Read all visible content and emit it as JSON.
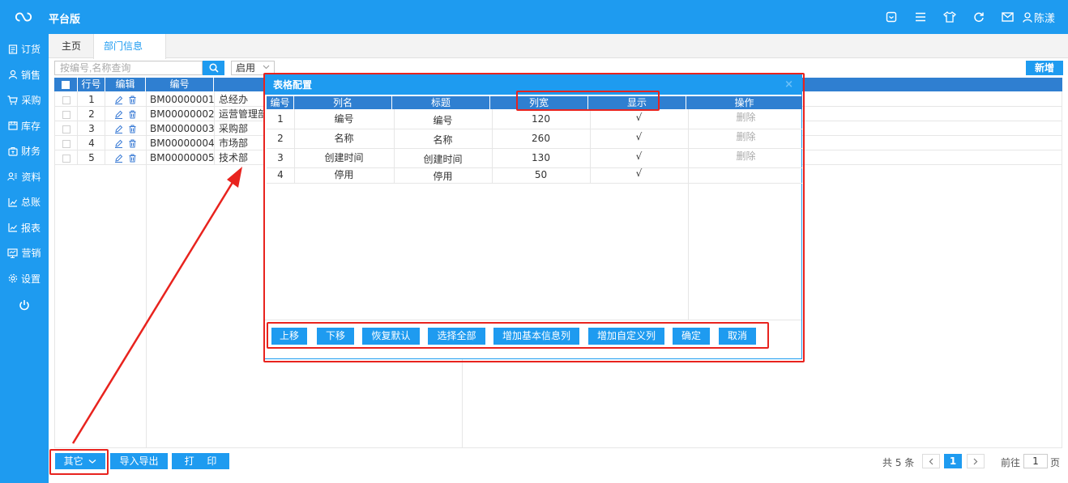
{
  "app": {
    "brand": "平台版",
    "user_name": "陈漾"
  },
  "sidebar": {
    "items": [
      {
        "label": "订货",
        "icon": "document-icon"
      },
      {
        "label": "销售",
        "icon": "person-icon"
      },
      {
        "label": "采购",
        "icon": "cart-icon"
      },
      {
        "label": "库存",
        "icon": "inventory-icon"
      },
      {
        "label": "财务",
        "icon": "finance-icon"
      },
      {
        "label": "资料",
        "icon": "contacts-icon"
      },
      {
        "label": "总账",
        "icon": "chart-icon"
      },
      {
        "label": "报表",
        "icon": "report-icon"
      },
      {
        "label": "营销",
        "icon": "monitor-icon"
      },
      {
        "label": "设置",
        "icon": "gear-icon"
      }
    ]
  },
  "tabs": {
    "home": "主页",
    "active": "部门信息",
    "close": "×"
  },
  "toolbar": {
    "search_placeholder": "按编号,名称查询",
    "status_value": "启用",
    "add_label": "新增"
  },
  "grid": {
    "headers": {
      "row_no": "行号",
      "edit": "编辑",
      "code": "编号"
    },
    "rows": [
      {
        "no": "1",
        "code": "BM00000001",
        "name": "总经办"
      },
      {
        "no": "2",
        "code": "BM00000002",
        "name": "运营管理部"
      },
      {
        "no": "3",
        "code": "BM00000003",
        "name": "采购部"
      },
      {
        "no": "4",
        "code": "BM00000004",
        "name": "市场部"
      },
      {
        "no": "5",
        "code": "BM00000005",
        "name": "技术部"
      }
    ]
  },
  "dialog": {
    "title": "表格配置",
    "close": "×",
    "headers": {
      "no": "编号",
      "col": "列名",
      "caption": "标题",
      "width": "列宽",
      "show": "显示",
      "op": "操作"
    },
    "rows": [
      {
        "no": "1",
        "col": "编号",
        "caption": "编号",
        "width": "120",
        "show": "√",
        "op": "删除"
      },
      {
        "no": "2",
        "col": "名称",
        "caption": "名称",
        "width": "260",
        "show": "√",
        "op": "删除"
      },
      {
        "no": "3",
        "col": "创建时间",
        "caption": "创建时间",
        "width": "130",
        "show": "√",
        "op": "删除"
      },
      {
        "no": "4",
        "col": "停用",
        "caption": "停用",
        "width": "50",
        "show": "√",
        "op": ""
      }
    ],
    "buttons": {
      "up": "上移",
      "down": "下移",
      "reset": "恢复默认",
      "select_all": "选择全部",
      "add_basic": "增加基本信息列",
      "add_custom": "增加自定义列",
      "ok": "确定",
      "cancel": "取消"
    }
  },
  "bottom": {
    "other": "其它",
    "import_export": "导入导出",
    "print": "打　 印",
    "total": "共 5 条",
    "current_page": "1",
    "goto_prefix": "前往",
    "goto_value": "1",
    "goto_suffix": "页"
  },
  "colors": {
    "primary": "#1e9bf0",
    "header_blue": "#2f7fd1",
    "annotation_red": "#e8231e"
  }
}
